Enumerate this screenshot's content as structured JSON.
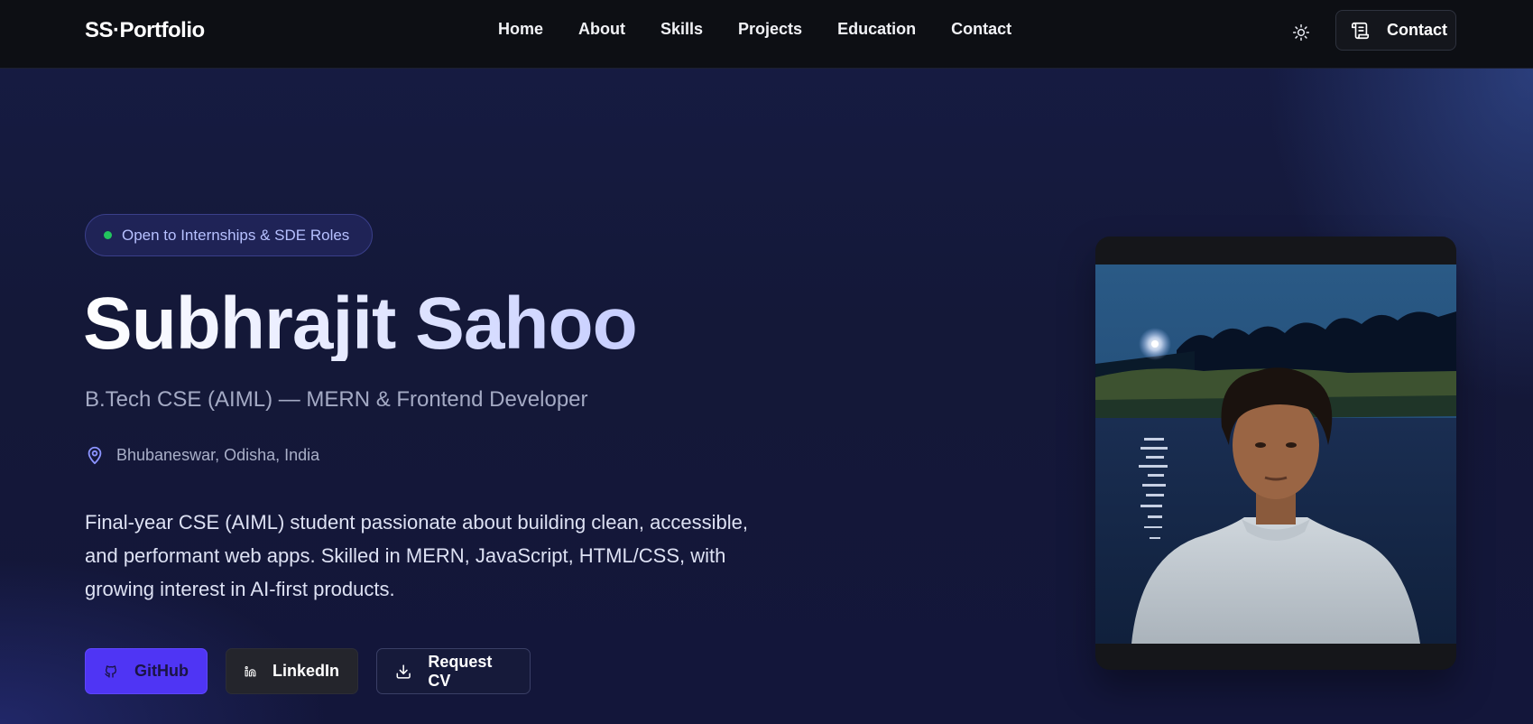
{
  "nav": {
    "logo": "SS·Portfolio",
    "links": [
      "Home",
      "About",
      "Skills",
      "Projects",
      "Education",
      "Contact"
    ],
    "theme_icon": "sun-icon",
    "contact_button_label": "Contact",
    "contact_button_icon": "scroll-icon"
  },
  "hero": {
    "badge": "Open to Internships & SDE Roles",
    "name": "Subhrajit Sahoo",
    "title": "B.Tech CSE (AIML) — MERN & Frontend Developer",
    "location": "Bhubaneswar, Odisha, India",
    "bio": "Final-year CSE (AIML) student passionate about building clean, accessible, and performant web apps. Skilled in MERN, JavaScript, HTML/CSS, with growing interest in AI-first products.",
    "buttons": {
      "github": "GitHub",
      "linkedin": "LinkedIn",
      "cv": "Request CV"
    }
  },
  "colors": {
    "accent": "#4f35f4",
    "status_dot": "#22c55e",
    "badge_text": "#b6c0ff"
  }
}
